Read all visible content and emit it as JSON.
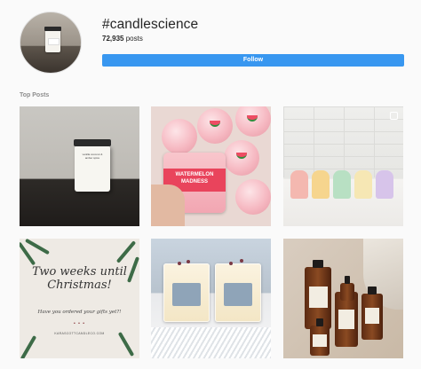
{
  "header": {
    "hashtag": "#candlescience",
    "post_count": "72,935",
    "post_suffix": " posts",
    "follow_label": "Follow",
    "follow_color": "#3897f0"
  },
  "section": {
    "label": "Top Posts"
  },
  "posts": {
    "p1": {
      "label_text": "vanilla coconut & amber spice"
    },
    "p2": {
      "jar_text": "WATERMELON MADNESS"
    },
    "p3": {
      "has_multiple": true
    },
    "p4": {
      "headline": "Two weeks until Christmas!",
      "subline": "Have you ordered your gifts yet?!",
      "url": "KARASCOTTCANDLECO.COM"
    },
    "p5": {},
    "p6": {}
  },
  "icons": [
    "multiple-photos-icon"
  ]
}
